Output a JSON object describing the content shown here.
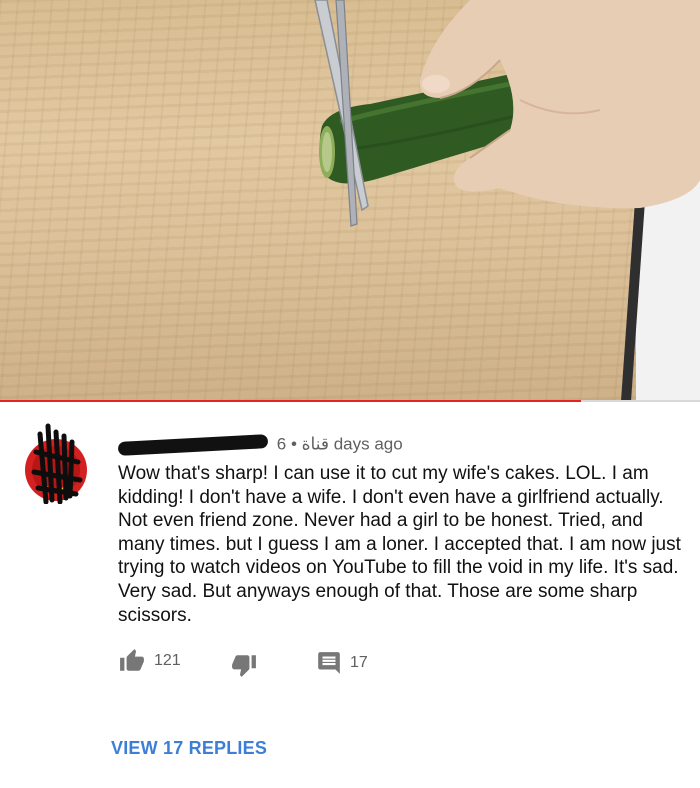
{
  "video": {
    "progress": 0.83
  },
  "comment": {
    "channel_tag": "قناة",
    "separator": "•",
    "time_ago": "6 days ago",
    "text": "Wow that's sharp! I can use it to cut my wife's cakes. LOL. I am kidding! I don't have a wife. I don't even have a girlfriend actually. Not even friend zone. Never had a girl to be honest. Tried, and many times. but I guess I am a loner. I accepted that. I am now just trying to watch videos on YouTube to fill the void in my life. It's sad. Very sad. But anyways enough of that. Those are some sharp scissors.",
    "likes": "121",
    "replies_count": "17",
    "view_replies_label": "VIEW 17 REPLIES"
  },
  "icons": {
    "like": "thumb-up-icon",
    "dislike": "thumb-down-icon",
    "reply": "comment-icon",
    "more": "more-vert-icon"
  },
  "colors": {
    "progress": "#e52222",
    "link": "#3d7fd6",
    "meta_text": "#606060"
  }
}
